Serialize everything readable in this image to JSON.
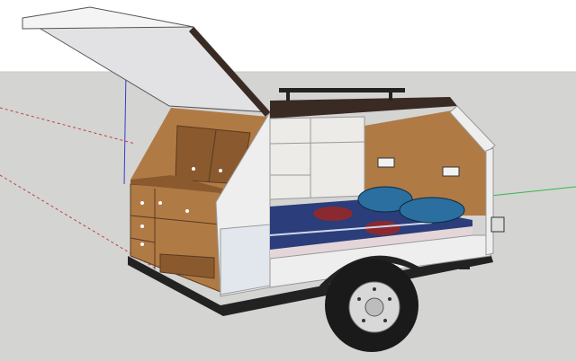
{
  "viewport": {
    "sky_color": "#ffffff",
    "ground_color": "#d4d4d2",
    "horizon_color": "#c8c8c4"
  },
  "axes": {
    "red_axis_color": "#c04040",
    "green_axis_color": "#39b54a",
    "blue_axis_color": "#3a3ad0"
  },
  "model": {
    "name": "teardrop-camper-trailer",
    "hatch_color": "#e2e2e4",
    "shell_color": "#eeeeee",
    "trim_color": "#3a2a24",
    "wood_color": "#b07a45",
    "wood_dark_color": "#8a5a2e",
    "cabinet_color": "#ecebe8",
    "mattress_color": "#2b3d7a",
    "pillow_color": "#2a6fa0",
    "tire_color": "#1a1a1a",
    "rim_color": "#d8d8d8",
    "chassis_color": "#222222"
  }
}
